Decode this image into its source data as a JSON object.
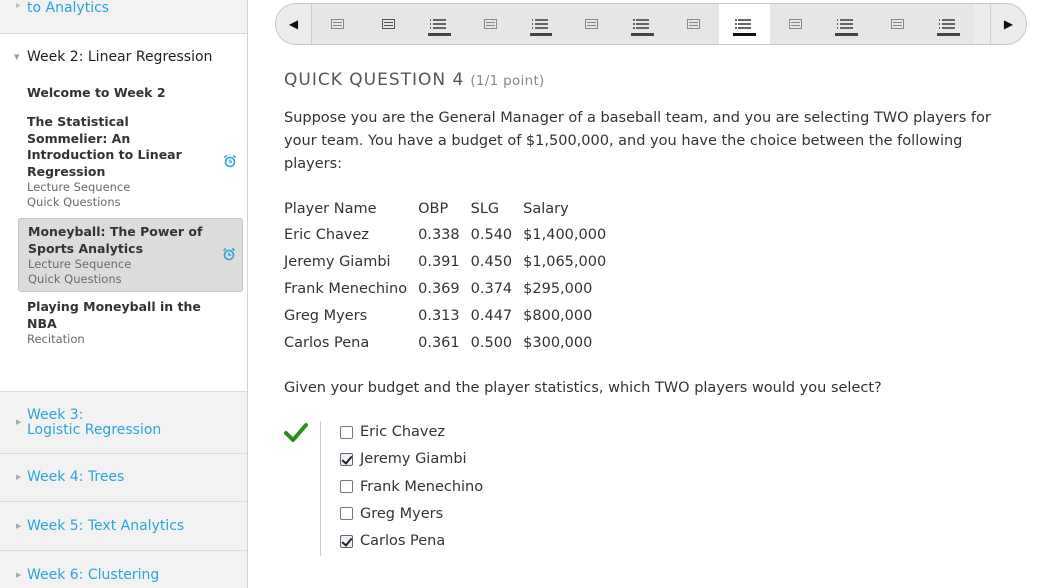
{
  "sidebar": {
    "prev_link": "to Analytics",
    "open_week": "Week 2: Linear Regression",
    "items": [
      {
        "title_lines": [
          "Welcome to Week 2"
        ],
        "subs": []
      },
      {
        "title_lines": [
          "The Statistical",
          "Sommelier: An",
          "Introduction to Linear",
          "Regression"
        ],
        "subs": [
          "Lecture Sequence",
          "Quick Questions"
        ]
      },
      {
        "title_lines": [
          "Moneyball: The Power of",
          "Sports Analytics"
        ],
        "subs": [
          "Lecture Sequence",
          "Quick Questions"
        ]
      },
      {
        "title_lines": [
          "Playing Moneyball in the",
          "NBA"
        ],
        "subs": [
          "Recitation"
        ]
      }
    ],
    "weeks": [
      {
        "line1": "Week 3:",
        "line2": "Logistic Regression"
      },
      {
        "line1": "Week 4: Trees"
      },
      {
        "line1": "Week 5: Text Analytics"
      },
      {
        "line1": "Week 6: Clustering"
      }
    ]
  },
  "seqnav": {
    "prev_icon": "triangle-left-icon",
    "next_icon": "triangle-right-icon",
    "tabs": [
      "video",
      "video",
      "problem",
      "video",
      "problem",
      "video",
      "problem",
      "video",
      "problem",
      "video",
      "problem",
      "video",
      "problem"
    ],
    "active_index": 8
  },
  "question": {
    "title": "QUICK QUESTION 4",
    "points": "(1/1 point)",
    "prompt": "Suppose you are the General Manager of a baseball team, and you are selecting TWO players for your team. You have a budget of $1,500,000, and you have the choice between the following players:",
    "table": {
      "headers": [
        "Player Name",
        "OBP",
        "SLG",
        "Salary"
      ],
      "rows": [
        [
          "Eric Chavez",
          "0.338",
          "0.540",
          "$1,400,000"
        ],
        [
          "Jeremy Giambi",
          "0.391",
          "0.450",
          "$1,065,000"
        ],
        [
          "Frank Menechino",
          "0.369",
          "0.374",
          "$295,000"
        ],
        [
          "Greg Myers",
          "0.313",
          "0.447",
          "$800,000"
        ],
        [
          "Carlos Pena",
          "0.361",
          "0.500",
          "$300,000"
        ]
      ]
    },
    "question2": "Given your budget and the player statistics, which TWO players would you select?",
    "status": "correct",
    "status_color": "#2e8b1f",
    "choices": [
      {
        "label": "Eric Chavez",
        "checked": false
      },
      {
        "label": "Jeremy Giambi",
        "checked": true
      },
      {
        "label": "Frank Menechino",
        "checked": false
      },
      {
        "label": "Greg Myers",
        "checked": false
      },
      {
        "label": "Carlos Pena",
        "checked": true
      }
    ]
  },
  "colors": {
    "link": "#2aa5d6",
    "text": "#333333",
    "sidebar_bg": "#f2f2f2"
  }
}
